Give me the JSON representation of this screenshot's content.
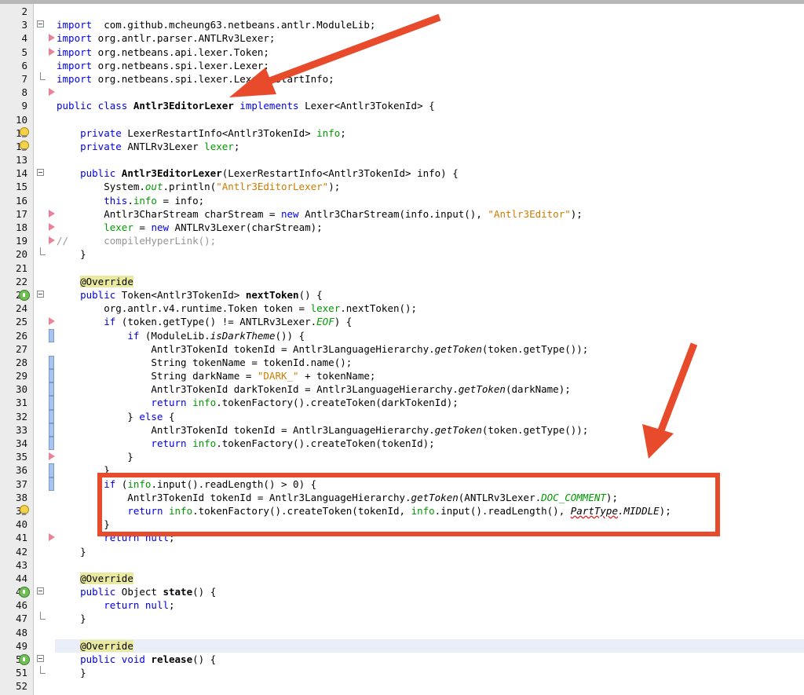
{
  "editor": {
    "lines": [
      {
        "n": "2",
        "parts": []
      },
      {
        "n": "3",
        "fold": "open",
        "parts": [
          [
            "kw",
            "import"
          ],
          [
            "",
            "  com.github.mcheung63.netbeans.antlr.ModuleLib;"
          ]
        ]
      },
      {
        "n": "4",
        "mark": "arrow",
        "parts": [
          [
            "kw",
            "import"
          ],
          [
            "",
            " org.antlr.parser.ANTLRv3Lexer;"
          ]
        ]
      },
      {
        "n": "5",
        "mark": "arrow",
        "parts": [
          [
            "kw",
            "import"
          ],
          [
            "",
            " org.netbeans.api.lexer.Token;"
          ]
        ]
      },
      {
        "n": "6",
        "parts": [
          [
            "kw",
            "import"
          ],
          [
            "",
            " org.netbeans.spi.lexer.Lexer;"
          ]
        ]
      },
      {
        "n": "7",
        "fold": "end",
        "parts": [
          [
            "kw",
            "import"
          ],
          [
            "",
            " org.netbeans.spi.lexer.LexerRestartInfo;"
          ]
        ]
      },
      {
        "n": "8",
        "mark": "arrow",
        "parts": []
      },
      {
        "n": "9",
        "parts": [
          [
            "kw",
            "public class "
          ],
          [
            "bold",
            "Antlr3EditorLexer"
          ],
          [
            "kw",
            " implements "
          ],
          [
            "",
            "Lexer<Antlr3TokenId> {"
          ]
        ]
      },
      {
        "n": "10",
        "parts": []
      },
      {
        "n": "11",
        "mark": "bulb",
        "parts": [
          [
            "",
            "    "
          ],
          [
            "kw",
            "private "
          ],
          [
            "",
            "LexerRestartInfo<Antlr3TokenId> "
          ],
          [
            "fld",
            "info"
          ],
          [
            "",
            ";"
          ]
        ]
      },
      {
        "n": "12",
        "mark": "bulb",
        "parts": [
          [
            "",
            "    "
          ],
          [
            "kw",
            "private "
          ],
          [
            "",
            "ANTLRv3Lexer "
          ],
          [
            "fld",
            "lexer"
          ],
          [
            "",
            ";"
          ]
        ]
      },
      {
        "n": "13",
        "parts": []
      },
      {
        "n": "14",
        "fold": "open",
        "parts": [
          [
            "",
            "    "
          ],
          [
            "kw",
            "public "
          ],
          [
            "bold",
            "Antlr3EditorLexer"
          ],
          [
            "",
            "(LexerRestartInfo<Antlr3TokenId> info) {"
          ]
        ]
      },
      {
        "n": "15",
        "parts": [
          [
            "",
            "        System."
          ],
          [
            "fld ital",
            "out"
          ],
          [
            "",
            ".println("
          ],
          [
            "str",
            "\"Antlr3EditorLexer\""
          ],
          [
            "",
            ");"
          ]
        ]
      },
      {
        "n": "16",
        "parts": [
          [
            "",
            "        "
          ],
          [
            "kw",
            "this"
          ],
          [
            "",
            "."
          ],
          [
            "fld",
            "info"
          ],
          [
            "",
            " = info;"
          ]
        ]
      },
      {
        "n": "17",
        "mark": "arrow",
        "parts": [
          [
            "",
            "        Antlr3CharStream charStream = "
          ],
          [
            "kw",
            "new "
          ],
          [
            "",
            "Antlr3CharStream(info.input(), "
          ],
          [
            "str",
            "\"Antlr3Editor\""
          ],
          [
            "",
            ");"
          ]
        ]
      },
      {
        "n": "18",
        "mark": "arrow",
        "parts": [
          [
            "",
            "        "
          ],
          [
            "fld",
            "lexer"
          ],
          [
            "",
            " = "
          ],
          [
            "kw",
            "new "
          ],
          [
            "",
            "ANTLRv3Lexer(charStream);"
          ]
        ]
      },
      {
        "n": "19",
        "mark": "arrow",
        "parts": [
          [
            "cmt",
            "//      compileHyperLink();"
          ]
        ]
      },
      {
        "n": "20",
        "fold": "end",
        "parts": [
          [
            "",
            "    }"
          ]
        ]
      },
      {
        "n": "21",
        "parts": []
      },
      {
        "n": "22",
        "parts": [
          [
            "",
            "    "
          ],
          [
            "ann",
            "@Override"
          ]
        ]
      },
      {
        "n": "23",
        "mark": "impl",
        "fold": "open",
        "parts": [
          [
            "",
            "    "
          ],
          [
            "kw",
            "public "
          ],
          [
            "",
            "Token<Antlr3TokenId> "
          ],
          [
            "bold",
            "nextToken"
          ],
          [
            "",
            "() {"
          ]
        ]
      },
      {
        "n": "24",
        "parts": [
          [
            "",
            "        org.antlr.v4.runtime.Token token = "
          ],
          [
            "fld",
            "lexer"
          ],
          [
            "",
            ".nextToken();"
          ]
        ]
      },
      {
        "n": "25",
        "mark": "arrow",
        "parts": [
          [
            "",
            "        "
          ],
          [
            "kw",
            "if "
          ],
          [
            "",
            "(token.getType() != ANTLRv3Lexer."
          ],
          [
            "fld ital",
            "EOF"
          ],
          [
            "",
            ") {"
          ]
        ]
      },
      {
        "n": "26",
        "mark": "change",
        "parts": [
          [
            "",
            "            "
          ],
          [
            "kw",
            "if "
          ],
          [
            "",
            "(ModuleLib."
          ],
          [
            "ital",
            "isDarkTheme"
          ],
          [
            "",
            "()) {"
          ]
        ]
      },
      {
        "n": "27",
        "parts": [
          [
            "",
            "                Antlr3TokenId tokenId = Antlr3LanguageHierarchy."
          ],
          [
            "ital",
            "getToken"
          ],
          [
            "",
            "(token.getType());"
          ]
        ]
      },
      {
        "n": "28",
        "mark": "change",
        "parts": [
          [
            "",
            "                String tokenName = tokenId.name();"
          ]
        ]
      },
      {
        "n": "29",
        "mark": "change",
        "parts": [
          [
            "",
            "                String darkName = "
          ],
          [
            "str",
            "\"DARK_\""
          ],
          [
            "",
            " + tokenName;"
          ]
        ]
      },
      {
        "n": "30",
        "mark": "change",
        "parts": [
          [
            "",
            "                Antlr3TokenId darkTokenId = Antlr3LanguageHierarchy."
          ],
          [
            "ital",
            "getToken"
          ],
          [
            "",
            "(darkName);"
          ]
        ]
      },
      {
        "n": "31",
        "mark": "change",
        "parts": [
          [
            "",
            "                "
          ],
          [
            "kw",
            "return "
          ],
          [
            "fld",
            "info"
          ],
          [
            "",
            ".tokenFactory().createToken(darkTokenId);"
          ]
        ]
      },
      {
        "n": "32",
        "mark": "change",
        "parts": [
          [
            "",
            "            } "
          ],
          [
            "kw",
            "else "
          ],
          [
            "",
            "{"
          ]
        ]
      },
      {
        "n": "33",
        "mark": "change",
        "parts": [
          [
            "",
            "                Antlr3TokenId tokenId = Antlr3LanguageHierarchy."
          ],
          [
            "ital",
            "getToken"
          ],
          [
            "",
            "(token.getType());"
          ]
        ]
      },
      {
        "n": "34",
        "mark": "change",
        "parts": [
          [
            "",
            "                "
          ],
          [
            "kw",
            "return "
          ],
          [
            "fld",
            "info"
          ],
          [
            "",
            ".tokenFactory().createToken(tokenId);"
          ]
        ]
      },
      {
        "n": "35",
        "mark": "arrow",
        "parts": [
          [
            "",
            "            }"
          ]
        ]
      },
      {
        "n": "36",
        "mark": "change",
        "parts": [
          [
            "",
            "        }"
          ]
        ]
      },
      {
        "n": "37",
        "mark": "change",
        "parts": [
          [
            "",
            "        "
          ],
          [
            "kw",
            "if "
          ],
          [
            "",
            "("
          ],
          [
            "fld",
            "info"
          ],
          [
            "",
            ".input().readLength() > 0) {"
          ]
        ]
      },
      {
        "n": "38",
        "parts": [
          [
            "",
            "            Antlr3TokenId tokenId = Antlr3LanguageHierarchy."
          ],
          [
            "ital",
            "getToken"
          ],
          [
            "",
            "(ANTLRv3Lexer."
          ],
          [
            "fld ital",
            "DOC_COMMENT"
          ],
          [
            "",
            ");"
          ]
        ]
      },
      {
        "n": "39",
        "mark": "bulb",
        "parts": [
          [
            "",
            "            "
          ],
          [
            "kw",
            "return "
          ],
          [
            "fld",
            "info"
          ],
          [
            "",
            ".tokenFactory().createToken(tokenId, "
          ],
          [
            "fld",
            "info"
          ],
          [
            "",
            ".input().readLength(), "
          ],
          [
            "ital err",
            "PartType"
          ],
          [
            "ital",
            ".MIDDLE"
          ],
          [
            "",
            ");"
          ]
        ]
      },
      {
        "n": "40",
        "parts": [
          [
            "",
            "        }"
          ]
        ]
      },
      {
        "n": "41",
        "mark": "arrow",
        "parts": [
          [
            "",
            "        "
          ],
          [
            "kw",
            "return null"
          ],
          [
            "",
            ";"
          ]
        ]
      },
      {
        "n": "42",
        "parts": [
          [
            "",
            "    }"
          ]
        ]
      },
      {
        "n": "43",
        "parts": []
      },
      {
        "n": "44",
        "parts": [
          [
            "",
            "    "
          ],
          [
            "ann",
            "@Override"
          ]
        ]
      },
      {
        "n": "45",
        "mark": "impl",
        "fold": "open",
        "parts": [
          [
            "",
            "    "
          ],
          [
            "kw",
            "public "
          ],
          [
            "",
            "Object "
          ],
          [
            "bold",
            "state"
          ],
          [
            "",
            "() {"
          ]
        ]
      },
      {
        "n": "46",
        "parts": [
          [
            "",
            "        "
          ],
          [
            "kw",
            "return null"
          ],
          [
            "",
            ";"
          ]
        ]
      },
      {
        "n": "47",
        "fold": "end",
        "parts": [
          [
            "",
            "    }"
          ]
        ]
      },
      {
        "n": "48",
        "parts": []
      },
      {
        "n": "49",
        "current": true,
        "parts": [
          [
            "",
            "    "
          ],
          [
            "ann",
            "@Override"
          ]
        ]
      },
      {
        "n": "50",
        "mark": "impl",
        "fold": "open",
        "parts": [
          [
            "",
            "    "
          ],
          [
            "kw",
            "public void "
          ],
          [
            "bold",
            "release"
          ],
          [
            "",
            "() {"
          ]
        ]
      },
      {
        "n": "51",
        "fold": "end",
        "parts": [
          [
            "",
            "    }"
          ]
        ]
      },
      {
        "n": "52",
        "parts": []
      }
    ]
  }
}
